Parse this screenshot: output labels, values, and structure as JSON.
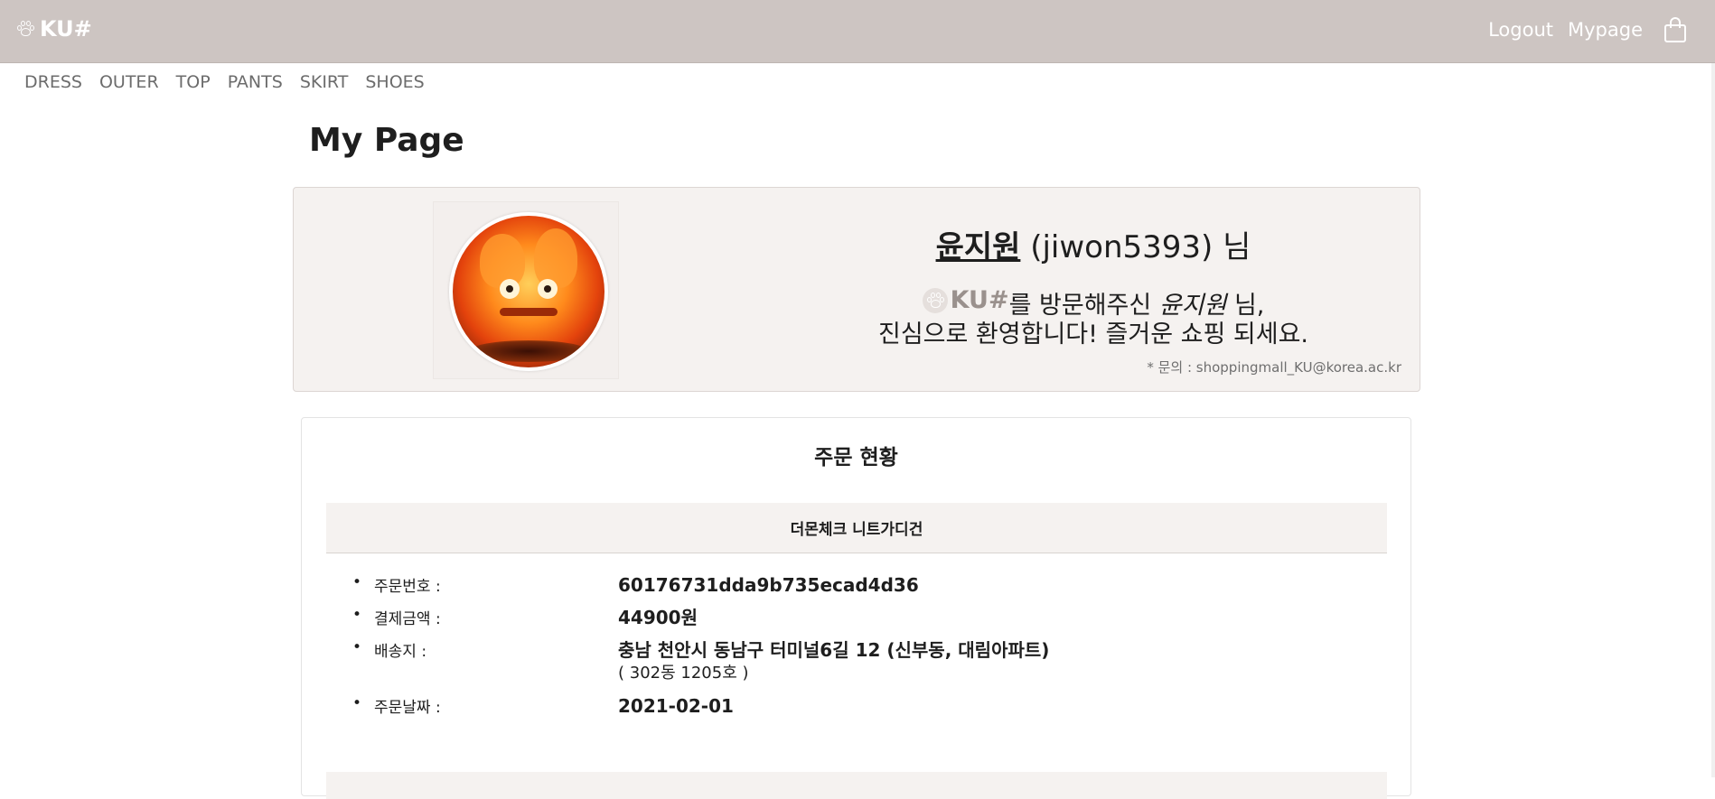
{
  "header": {
    "brand": "KU#",
    "logout": "Logout",
    "mypage": "Mypage",
    "cart_icon": "shopping-bag-icon"
  },
  "categories": [
    "DRESS",
    "OUTER",
    "TOP",
    "PANTS",
    "SKIRT",
    "SHOES"
  ],
  "page_title": "My Page",
  "profile": {
    "name": "윤지원",
    "user_id": "(jiwon5393)",
    "honorific": "님",
    "brand": "KU#",
    "msg_part1": "를 방문해주신 ",
    "msg_name": "윤지원",
    "msg_part2": " 님,",
    "msg_line2": "진심으로 환영합니다! 즐거운 쇼핑 되세요.",
    "contact": "* 문의 : shoppingmall_KU@korea.ac.kr"
  },
  "orders": {
    "title": "주문 현황",
    "items": [
      {
        "product": "더몬체크 니트가디건",
        "order_no_label": "주문번호 :",
        "order_no": "60176731dda9b735ecad4d36",
        "amount_label": "결제금액 :",
        "amount": "44900원",
        "address_label": "배송지 :",
        "address": "충남 천안시 동남구 터미널6길 12 (신부동, 대림아파트)",
        "address_detail": "( 302동 1205호 )",
        "date_label": "주문날짜 :",
        "date": "2021-02-01"
      }
    ]
  },
  "colors": {
    "header_bg": "#cdc5c2",
    "card_bg": "#f5f2f0",
    "brand_grey": "#9a918d"
  }
}
